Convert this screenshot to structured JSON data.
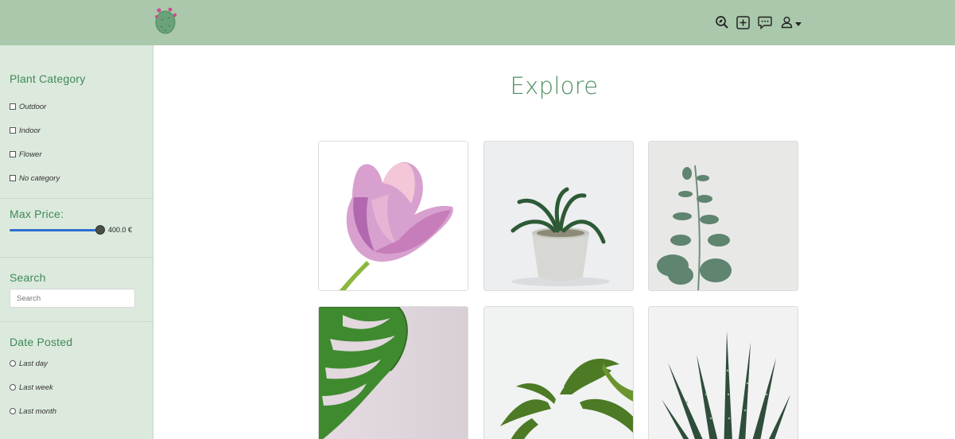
{
  "brand": {
    "logo_icon": "cactus-icon"
  },
  "header": {
    "icons": [
      "search-plant-icon",
      "add-post-icon",
      "messages-icon",
      "user-icon",
      "caret-down-icon"
    ]
  },
  "sidebar": {
    "category": {
      "title": "Plant Category",
      "options": [
        "Outdoor",
        "Indoor",
        "Flower",
        "No category"
      ]
    },
    "price": {
      "title": "Max Price:",
      "value_label": "400.0 €",
      "slider_fraction": 0.95
    },
    "search": {
      "title": "Search",
      "placeholder": "Search",
      "value": ""
    },
    "date": {
      "title": "Date Posted",
      "options": [
        "Last day",
        "Last week",
        "Last month"
      ]
    }
  },
  "main": {
    "title": "Explore",
    "cards": [
      {
        "subject": "pink-tulip"
      },
      {
        "subject": "succulent-in-pot"
      },
      {
        "subject": "eucalyptus-stem"
      },
      {
        "subject": "monstera-leaf"
      },
      {
        "subject": "palm-fronds"
      },
      {
        "subject": "aloe-succulent"
      }
    ]
  },
  "colors": {
    "topbar": "#aac8ab",
    "sidebar": "#dce9dd",
    "accent_green": "#4d8f5e",
    "slider_blue": "#2d6fd1"
  }
}
